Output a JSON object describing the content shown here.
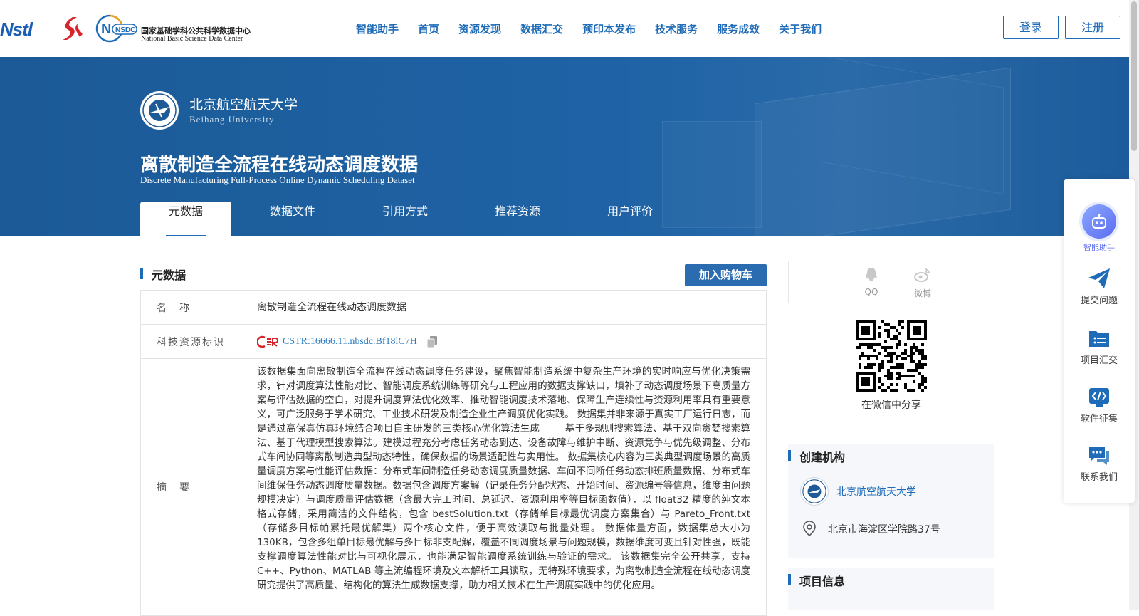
{
  "header": {
    "logos": {
      "nstl": "Nstl",
      "nsdc_badge": "NSDC",
      "nsdc_cn": "国家基础学科公共科学数据中心",
      "nsdc_en": "National Basic Science Data Center"
    },
    "nav": [
      "智能助手",
      "首页",
      "资源发现",
      "数据汇交",
      "预印本发布",
      "技术服务",
      "服务成效",
      "关于我们"
    ],
    "login_label": "登录",
    "register_label": "注册",
    "accent_color": "#1e6bb8"
  },
  "hero": {
    "university_cn": "北京航空航天大学",
    "university_en": "Beihang University",
    "title_cn": "离散制造全流程在线动态调度数据",
    "title_en": "Discrete Manufacturing Full-Process Online Dynamic Scheduling Dataset",
    "tabs": [
      "元数据",
      "数据文件",
      "引用方式",
      "推荐资源",
      "用户评价"
    ],
    "active_tab": "元数据"
  },
  "main": {
    "section_title": "元数据",
    "cart_button": "加入购物车",
    "metadata": {
      "name_label": "名　称",
      "name_value": "离散制造全流程在线动态调度数据",
      "id_label": "科技资源标识",
      "cstr_value": "CSTR:16666.11.nbsdc.Bf18lC7H",
      "abstract_label": "摘　要",
      "abstract_value": "该数据集面向离散制造全流程在线动态调度任务建设，聚焦智能制造系统中复杂生产环境的实时响应与优化决策需求，针对调度算法性能对比、智能调度系统训练等研究与工程应用的数据支撑缺口，填补了动态调度场景下高质量方案与评估数据的空白，对提升调度算法优化效率、推动智能调度技术落地、保障生产连续性与资源利用率具有重要意义，可广泛服务于学术研究、工业技术研发及制造企业生产调度优化实践。 数据集并非来源于真实工厂运行日志，而是通过高保真仿真环境结合项目自主研发的三类核心优化算法生成 —— 基于多规则搜索算法、基于双向贪婪搜索算法、基于代理模型搜索算法。建模过程充分考虑任务动态到达、设备故障与维护中断、资源竞争与优先级调整、分布式车间协同等离散制造典型动态特性，确保数据的场景适配性与实用性。 数据集核心内容为三类典型调度场景的高质量调度方案与性能评估数据：分布式车间制造任务动态调度质量数据、车间不间断任务动态排班质量数据、分布式车间维保任务动态调度质量数据。数据包含调度方案解（记录任务分配状态、开始时间、资源编号等信息，维度由问题规模决定）与调度质量评估数据（含最大完工时间、总延迟、资源利用率等目标函数值），以 float32 精度的纯文本格式存储，采用简洁的文件结构，包含 bestSolution.txt（存储单目标最优调度方案集合）与 Pareto_Front.txt（存储多目标帕累托最优解集）两个核心文件，便于高效读取与批量处理。 数据体量方面，数据集总大小为 130KB，包含多组单目标最优解与多目标非支配解，覆盖不同调度场景与问题规模，数据维度可变且针对性强，既能支撑调度算法性能对比与可视化展示，也能满足智能调度系统训练与验证的需求。 该数据集完全公开共享，支持 C++、Python、MATLAB 等主流编程环境及文本解析工具读取，无特殊环境要求，为离散制造全流程在线动态调度研究提供了高质量、结构化的算法生成数据支撑，助力相关技术在生产调度实践中的优化应用。"
    }
  },
  "sidebar": {
    "share": {
      "qq_label": "QQ",
      "weibo_label": "微博",
      "wechat_caption": "在微信中分享"
    },
    "creator_title": "创建机构",
    "creator_name": "北京航空航天大学",
    "creator_address": "北京市海淀区学院路37号",
    "project_title": "项目信息"
  },
  "floatbar": {
    "items": [
      "智能助手",
      "提交问题",
      "项目汇交",
      "软件征集",
      "联系我们"
    ]
  }
}
